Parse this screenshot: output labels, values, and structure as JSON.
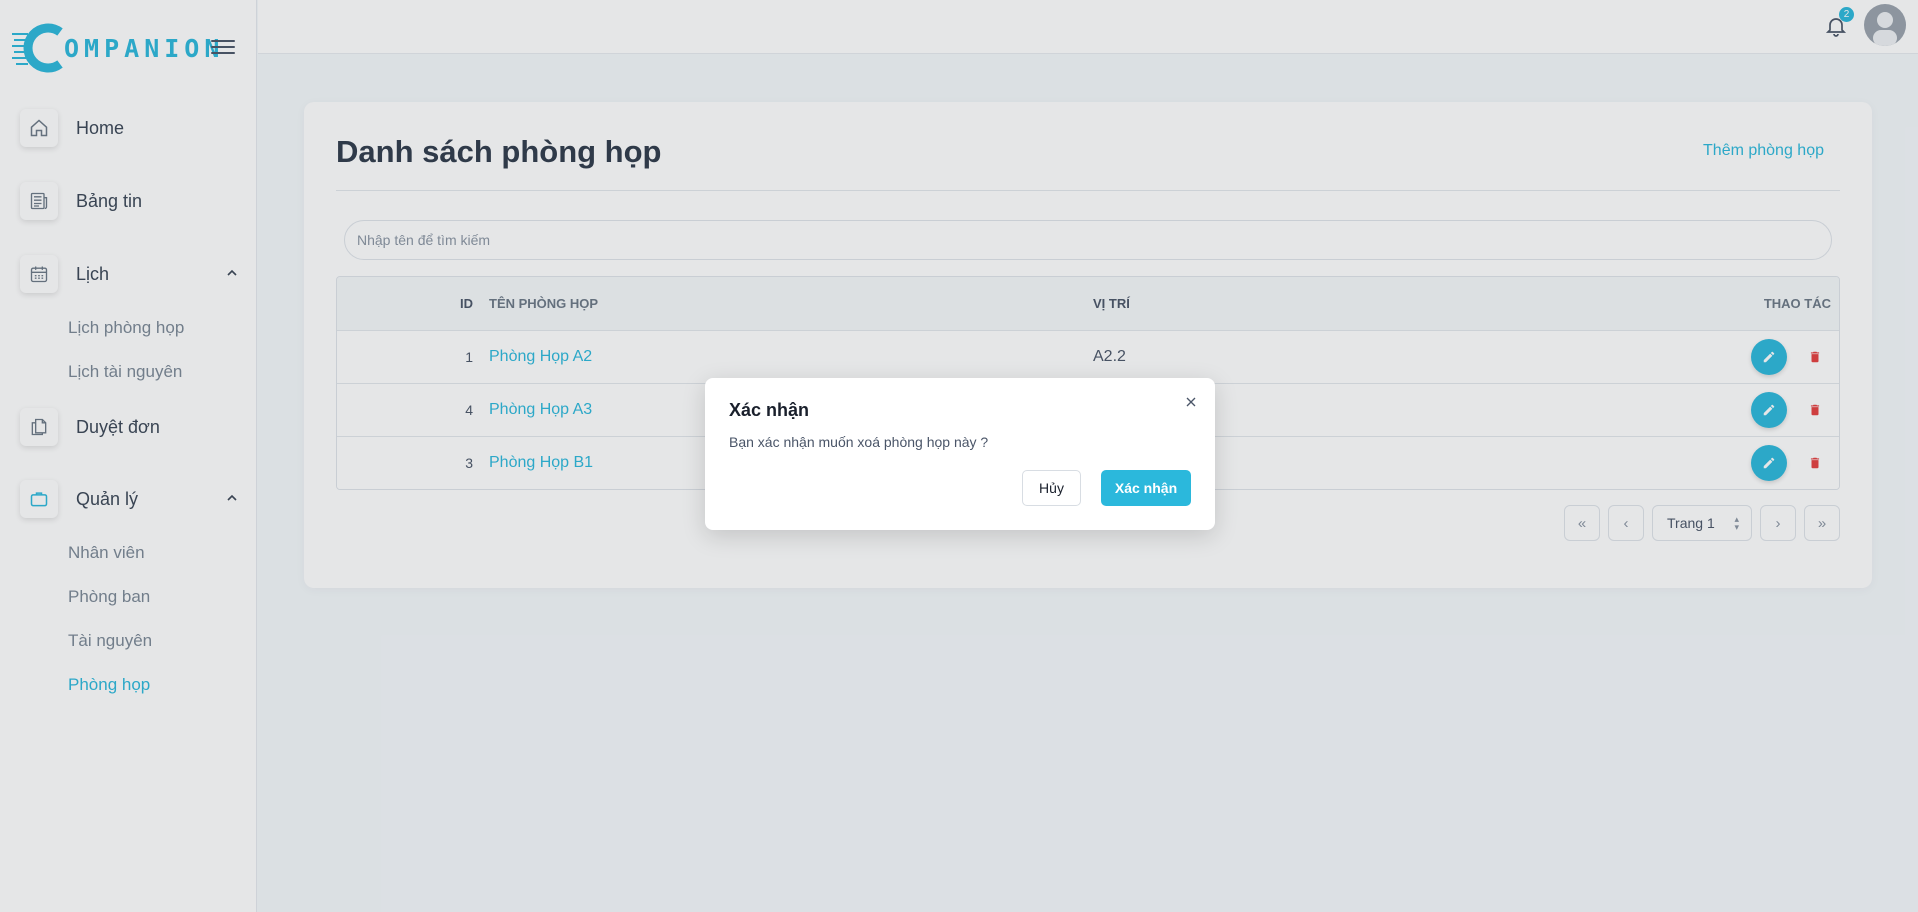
{
  "app": {
    "logo_text": "OMPANION",
    "notification_count": "2",
    "accent": "#2bb8dc"
  },
  "sidebar": {
    "items": [
      {
        "label": "Home",
        "icon": "home-icon"
      },
      {
        "label": "Bảng tin",
        "icon": "newspaper-icon"
      },
      {
        "label": "Lịch",
        "icon": "calendar-icon",
        "expanded": true,
        "children": [
          "Lịch phòng họp",
          "Lịch tài nguyên"
        ]
      },
      {
        "label": "Duyệt đơn",
        "icon": "documents-icon"
      },
      {
        "label": "Quản lý",
        "icon": "briefcase-icon",
        "expanded": true,
        "children": [
          "Nhân viên",
          "Phòng ban",
          "Tài nguyên",
          "Phòng họp"
        ]
      }
    ],
    "active_child": "Phòng họp"
  },
  "main": {
    "title": "Danh sách phòng họp",
    "add_label": "Thêm phòng họp",
    "search_placeholder": "Nhập tên để tìm kiếm",
    "columns": [
      "ID",
      "TÊN PHÒNG HỌP",
      "VỊ TRÍ",
      "THAO TÁC"
    ],
    "rows": [
      {
        "id": "1",
        "name": "Phòng Họp A2",
        "location": "A2.2"
      },
      {
        "id": "4",
        "name": "Phòng Họp A3",
        "location": ""
      },
      {
        "id": "3",
        "name": "Phòng Họp B1",
        "location": ""
      }
    ],
    "pager": {
      "first": "«",
      "prev": "‹",
      "page_label": "Trang 1",
      "next": "›",
      "last": "»"
    }
  },
  "modal": {
    "title": "Xác nhận",
    "body": "Bạn xác nhận muốn xoá phòng họp này ?",
    "cancel_label": "Hủy",
    "confirm_label": "Xác nhận"
  }
}
